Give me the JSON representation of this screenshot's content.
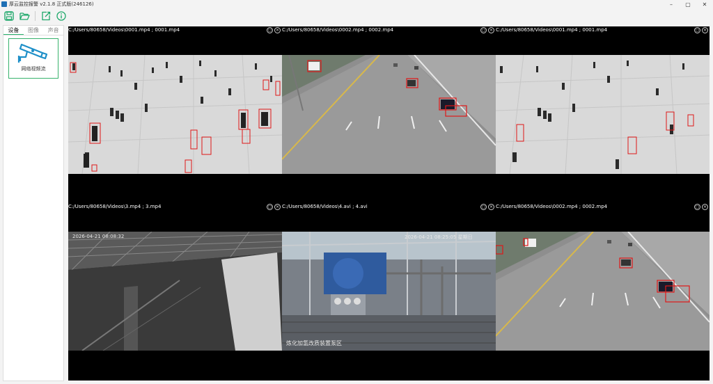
{
  "window": {
    "title": "厚云监控报警 v2.1.8  正式版(246126)",
    "minimize": "–",
    "maximize": "▢",
    "close": "✕"
  },
  "toolbar": {
    "save_icon": "save-icon",
    "open_icon": "folder-open-icon",
    "export_icon": "export-icon",
    "info_icon": "info-icon",
    "accent": "#1ea86a"
  },
  "sidebar": {
    "tabs": [
      {
        "label": "设备"
      },
      {
        "label": "图像"
      },
      {
        "label": "声音"
      }
    ],
    "device": {
      "label": "网络视频流",
      "icon": "cctv-camera-icon"
    }
  },
  "feeds": [
    {
      "caption": "C:/Users/80658/Videos\\0001.mp4 ; 0001.mp4",
      "scene": "crowd"
    },
    {
      "caption": "C:/Users/80658/Videos\\0002.mp4 ; 0002.mp4",
      "scene": "highway"
    },
    {
      "caption": "C:/Users/80658/Videos\\0001.mp4 ; 0001.mp4",
      "scene": "crowd"
    },
    {
      "caption": "C:/Users/80658/Videos\\3.mp4 ; 3.mp4",
      "scene": "night",
      "osd_time": "2026-04-21 08:08:32"
    },
    {
      "caption": "C:/Users/80658/Videos\\4.avi ; 4.avi",
      "scene": "plant",
      "osd_time": "2026-04-21 08:25:05 星期日",
      "osd_bottom": "炼化加氢改质装置泵区"
    },
    {
      "caption": "C:/Users/80658/Videos\\0002.mp4 ; 0002.mp4",
      "scene": "highway"
    }
  ],
  "colors": {
    "detection_box": "#e01818",
    "highlight": "#37b26c"
  }
}
